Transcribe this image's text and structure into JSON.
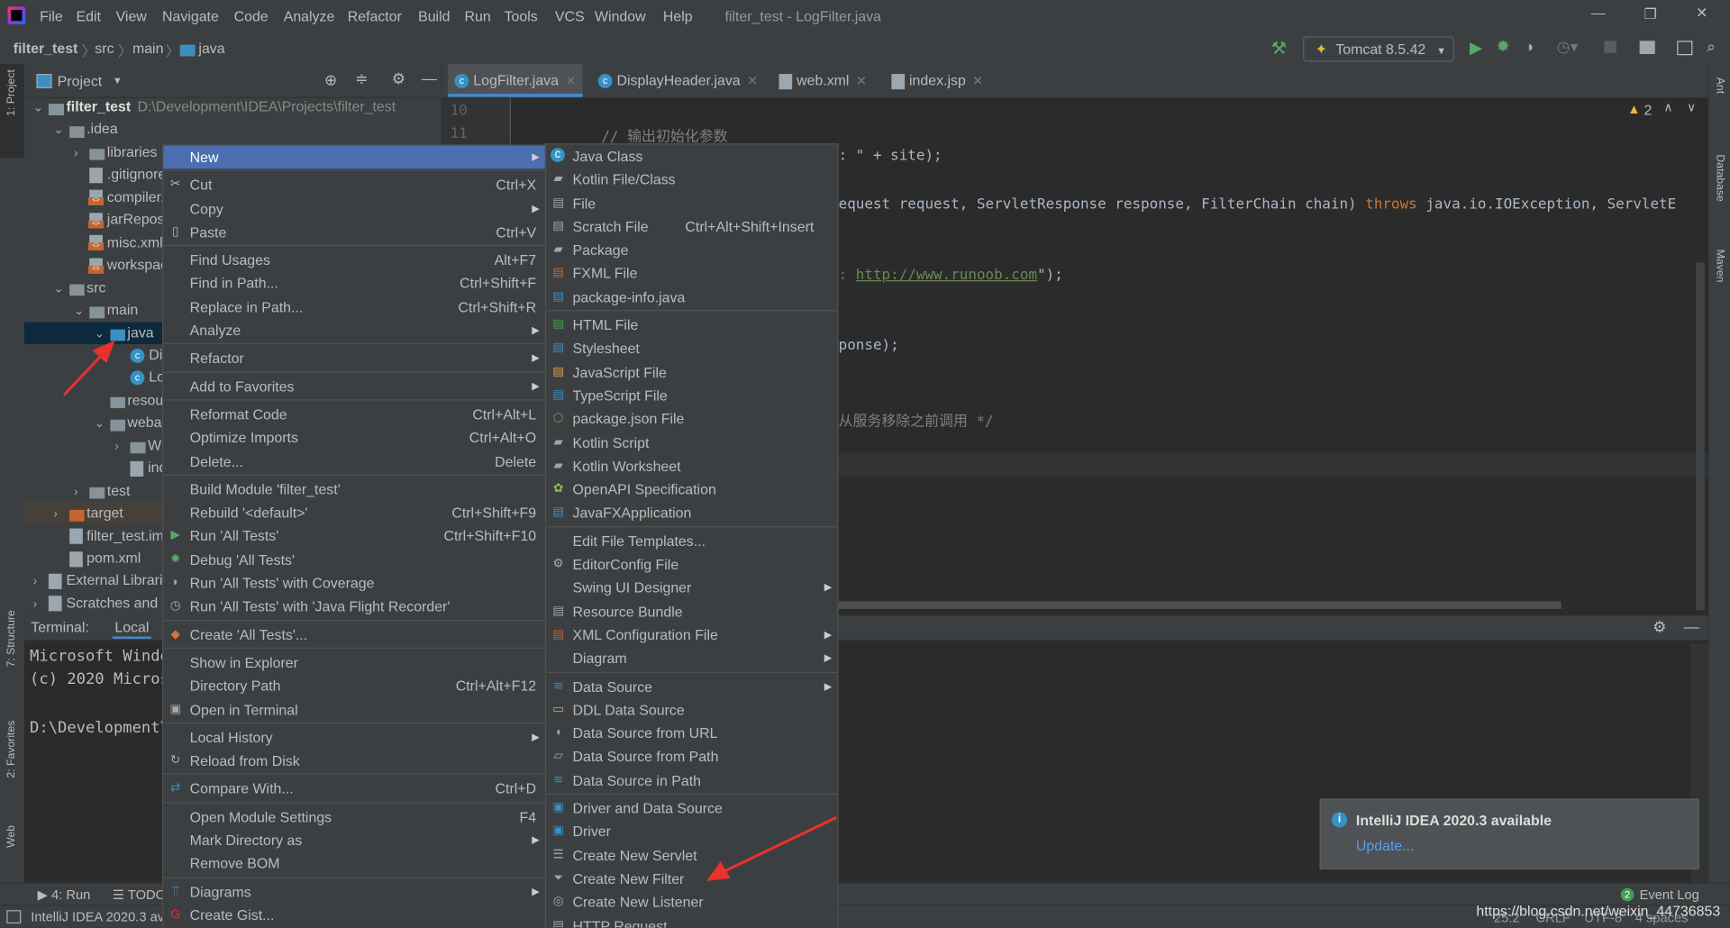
{
  "window": {
    "title": "filter_test - LogFilter.java",
    "menus": [
      "File",
      "Edit",
      "View",
      "Navigate",
      "Code",
      "Analyze",
      "Refactor",
      "Build",
      "Run",
      "Tools",
      "VCS",
      "Window",
      "Help"
    ]
  },
  "breadcrumb": [
    "filter_test",
    "src",
    "main",
    "java"
  ],
  "run_config": "Tomcat 8.5.42",
  "left_strip": {
    "project": "1: Project",
    "structure": "7: Structure",
    "favorites": "2: Favorites",
    "web": "Web"
  },
  "right_strip": {
    "ant": "Ant",
    "database": "Database",
    "maven": "Maven"
  },
  "project_panel": {
    "title": "Project",
    "tree": [
      {
        "label": "filter_test",
        "path": "D:\\Development\\IDEA\\Projects\\filter_test",
        "depth": 0,
        "icon": "module-folder",
        "open": true
      },
      {
        "label": ".idea",
        "depth": 1,
        "icon": "folder",
        "open": true
      },
      {
        "label": "libraries",
        "depth": 2,
        "icon": "folder",
        "closed": true
      },
      {
        "label": ".gitignore",
        "depth": 2,
        "icon": "file"
      },
      {
        "label": "compiler.xml",
        "depth": 2,
        "icon": "xml"
      },
      {
        "label": "jarRepositories.xml",
        "depth": 2,
        "icon": "xml"
      },
      {
        "label": "misc.xml",
        "depth": 2,
        "icon": "xml"
      },
      {
        "label": "workspace.xml",
        "depth": 2,
        "icon": "xml"
      },
      {
        "label": "src",
        "depth": 1,
        "icon": "folder",
        "open": true
      },
      {
        "label": "main",
        "depth": 2,
        "icon": "folder",
        "open": true
      },
      {
        "label": "java",
        "depth": 3,
        "icon": "folder-blue",
        "open": true,
        "selected": true
      },
      {
        "label": "DisplayHeader",
        "depth": 4,
        "icon": "class"
      },
      {
        "label": "LogFilter",
        "depth": 4,
        "icon": "class"
      },
      {
        "label": "resources",
        "depth": 3,
        "icon": "folder"
      },
      {
        "label": "webapp",
        "depth": 3,
        "icon": "folder",
        "open": true
      },
      {
        "label": "WEB-INF",
        "depth": 4,
        "icon": "folder",
        "closed": true
      },
      {
        "label": "index.jsp",
        "depth": 4,
        "icon": "jsp"
      },
      {
        "label": "test",
        "depth": 2,
        "icon": "folder",
        "closed": true
      },
      {
        "label": "target",
        "depth": 1,
        "icon": "folder-orange",
        "closed": true,
        "excluded": true
      },
      {
        "label": "filter_test.iml",
        "depth": 1,
        "icon": "file"
      },
      {
        "label": "pom.xml",
        "depth": 1,
        "icon": "maven"
      },
      {
        "label": "External Libraries",
        "depth": 0,
        "icon": "libraries",
        "closed": true
      },
      {
        "label": "Scratches and Consoles",
        "depth": 0,
        "icon": "scratches",
        "closed": true
      }
    ]
  },
  "tabs": [
    {
      "label": "LogFilter.java",
      "active": true
    },
    {
      "label": "DisplayHeader.java"
    },
    {
      "label": "web.xml"
    },
    {
      "label": "index.jsp"
    }
  ],
  "editor": {
    "line_numbers": [
      "10",
      "11"
    ],
    "warnings": "2",
    "lines": [
      {
        "text": "// 输出初始化参数",
        "kind": "comment"
      },
      {
        "text": ": \" + site);",
        "kind": "code"
      },
      {
        "pre": "equest request, ServletResponse response, FilterChain chain) ",
        "kw": "throws",
        "post": " java.io.IOException, ServletE",
        "kind": "mixed"
      },
      {
        "pre": ": ",
        "link": "http://www.runoob.com",
        "post": "\");",
        "kind": "link"
      },
      {
        "text": "ponse);",
        "kind": "code"
      },
      {
        "text": "从服务移除之前调用 */",
        "kind": "comment"
      }
    ]
  },
  "terminal": {
    "label": "Terminal:",
    "tab": "Local",
    "lines": [
      "Microsoft Windows",
      "(c) 2020 Microsoft",
      "",
      "D:\\Development\\"
    ]
  },
  "context_menu": [
    {
      "label": "New",
      "submenu": true,
      "highlight": true
    },
    {
      "sep": true,
      "label": "Cut",
      "shortcut": "Ctrl+X",
      "icon": "scissors"
    },
    {
      "label": "Copy",
      "submenu": true
    },
    {
      "label": "Paste",
      "shortcut": "Ctrl+V",
      "icon": "clipboard"
    },
    {
      "sep": true,
      "label": "Find Usages",
      "shortcut": "Alt+F7"
    },
    {
      "label": "Find in Path...",
      "shortcut": "Ctrl+Shift+F"
    },
    {
      "label": "Replace in Path...",
      "shortcut": "Ctrl+Shift+R"
    },
    {
      "label": "Analyze",
      "submenu": true
    },
    {
      "sep": true,
      "label": "Refactor",
      "submenu": true
    },
    {
      "sep": true,
      "label": "Add to Favorites",
      "submenu": true
    },
    {
      "sep": true,
      "label": "Reformat Code",
      "shortcut": "Ctrl+Alt+L"
    },
    {
      "label": "Optimize Imports",
      "shortcut": "Ctrl+Alt+O"
    },
    {
      "label": "Delete...",
      "shortcut": "Delete"
    },
    {
      "sep": true,
      "label": "Build Module 'filter_test'"
    },
    {
      "label": "Rebuild '<default>'",
      "shortcut": "Ctrl+Shift+F9"
    },
    {
      "label": "Run 'All Tests'",
      "shortcut": "Ctrl+Shift+F10",
      "icon": "run"
    },
    {
      "label": "Debug 'All Tests'",
      "icon": "debug"
    },
    {
      "label": "Run 'All Tests' with Coverage",
      "icon": "coverage"
    },
    {
      "label": "Run 'All Tests' with 'Java Flight Recorder'",
      "icon": "profiler"
    },
    {
      "sep": true,
      "label": "Create 'All Tests'...",
      "icon": "create-test"
    },
    {
      "sep": true,
      "label": "Show in Explorer"
    },
    {
      "label": "Directory Path",
      "shortcut": "Ctrl+Alt+F12"
    },
    {
      "label": "Open in Terminal",
      "icon": "terminal"
    },
    {
      "sep": true,
      "label": "Local History",
      "submenu": true
    },
    {
      "label": "Reload from Disk",
      "icon": "reload"
    },
    {
      "sep": true,
      "label": "Compare With...",
      "shortcut": "Ctrl+D",
      "icon": "compare"
    },
    {
      "sep": true,
      "label": "Open Module Settings",
      "shortcut": "F4"
    },
    {
      "label": "Mark Directory as",
      "submenu": true
    },
    {
      "label": "Remove BOM"
    },
    {
      "sep": true,
      "label": "Diagrams",
      "submenu": true,
      "icon": "diagram"
    },
    {
      "label": "Create Gist...",
      "icon": "gist"
    }
  ],
  "new_submenu": [
    {
      "label": "Java Class",
      "icon": "class"
    },
    {
      "label": "Kotlin File/Class",
      "icon": "kotlin"
    },
    {
      "label": "File",
      "icon": "file"
    },
    {
      "label": "Scratch File",
      "shortcut": "Ctrl+Alt+Shift+Insert",
      "icon": "scratch"
    },
    {
      "label": "Package",
      "icon": "package"
    },
    {
      "label": "FXML File",
      "icon": "xml"
    },
    {
      "label": "package-info.java",
      "icon": "java-file"
    },
    {
      "sep": true,
      "label": "HTML File",
      "icon": "html"
    },
    {
      "label": "Stylesheet",
      "icon": "css"
    },
    {
      "label": "JavaScript File",
      "icon": "js"
    },
    {
      "label": "TypeScript File",
      "icon": "ts"
    },
    {
      "label": "package.json File",
      "icon": "nodejs"
    },
    {
      "label": "Kotlin Script",
      "icon": "kotlin"
    },
    {
      "label": "Kotlin Worksheet",
      "icon": "kotlin"
    },
    {
      "label": "OpenAPI Specification",
      "icon": "openapi"
    },
    {
      "label": "JavaFXApplication",
      "icon": "java-file"
    },
    {
      "sep": true,
      "label": "Edit File Templates..."
    },
    {
      "label": "EditorConfig File",
      "icon": "gear"
    },
    {
      "label": "Swing UI Designer",
      "submenu": true
    },
    {
      "label": "Resource Bundle",
      "icon": "bundle"
    },
    {
      "label": "XML Configuration File",
      "submenu": true,
      "icon": "xml"
    },
    {
      "label": "Diagram",
      "submenu": true
    },
    {
      "sep": true,
      "label": "Data Source",
      "submenu": true,
      "icon": "database"
    },
    {
      "label": "DDL Data Source",
      "icon": "ddl"
    },
    {
      "label": "Data Source from URL",
      "icon": "url"
    },
    {
      "label": "Data Source from Path",
      "icon": "folder-open"
    },
    {
      "label": "Data Source in Path",
      "icon": "database"
    },
    {
      "sep": true,
      "label": "Driver and Data Source",
      "icon": "driver"
    },
    {
      "label": "Driver",
      "icon": "driver"
    },
    {
      "label": "Create New Servlet",
      "icon": "servlet"
    },
    {
      "label": "Create New Filter",
      "icon": "filter"
    },
    {
      "label": "Create New Listener",
      "icon": "listener"
    },
    {
      "label": "HTTP Request",
      "icon": "http"
    }
  ],
  "notification": {
    "title": "IntelliJ IDEA 2020.3 available",
    "action": "Update..."
  },
  "bottom_tools": {
    "run": "4: Run",
    "todo": "TODO",
    "event_log": "Event Log",
    "event_count": "2"
  },
  "status": {
    "message": "IntelliJ IDEA 2020.3 available",
    "position": "25:2",
    "line_sep": "CRLF",
    "encoding": "UTF-8",
    "indent": "4 spaces",
    "watermark": "https://blog.csdn.net/weixin_44736853"
  },
  "colors": {
    "highlight": "#4b6eaf",
    "selection": "#0d293e",
    "accent_arrow": "#e8322d",
    "link": "#589df6"
  }
}
